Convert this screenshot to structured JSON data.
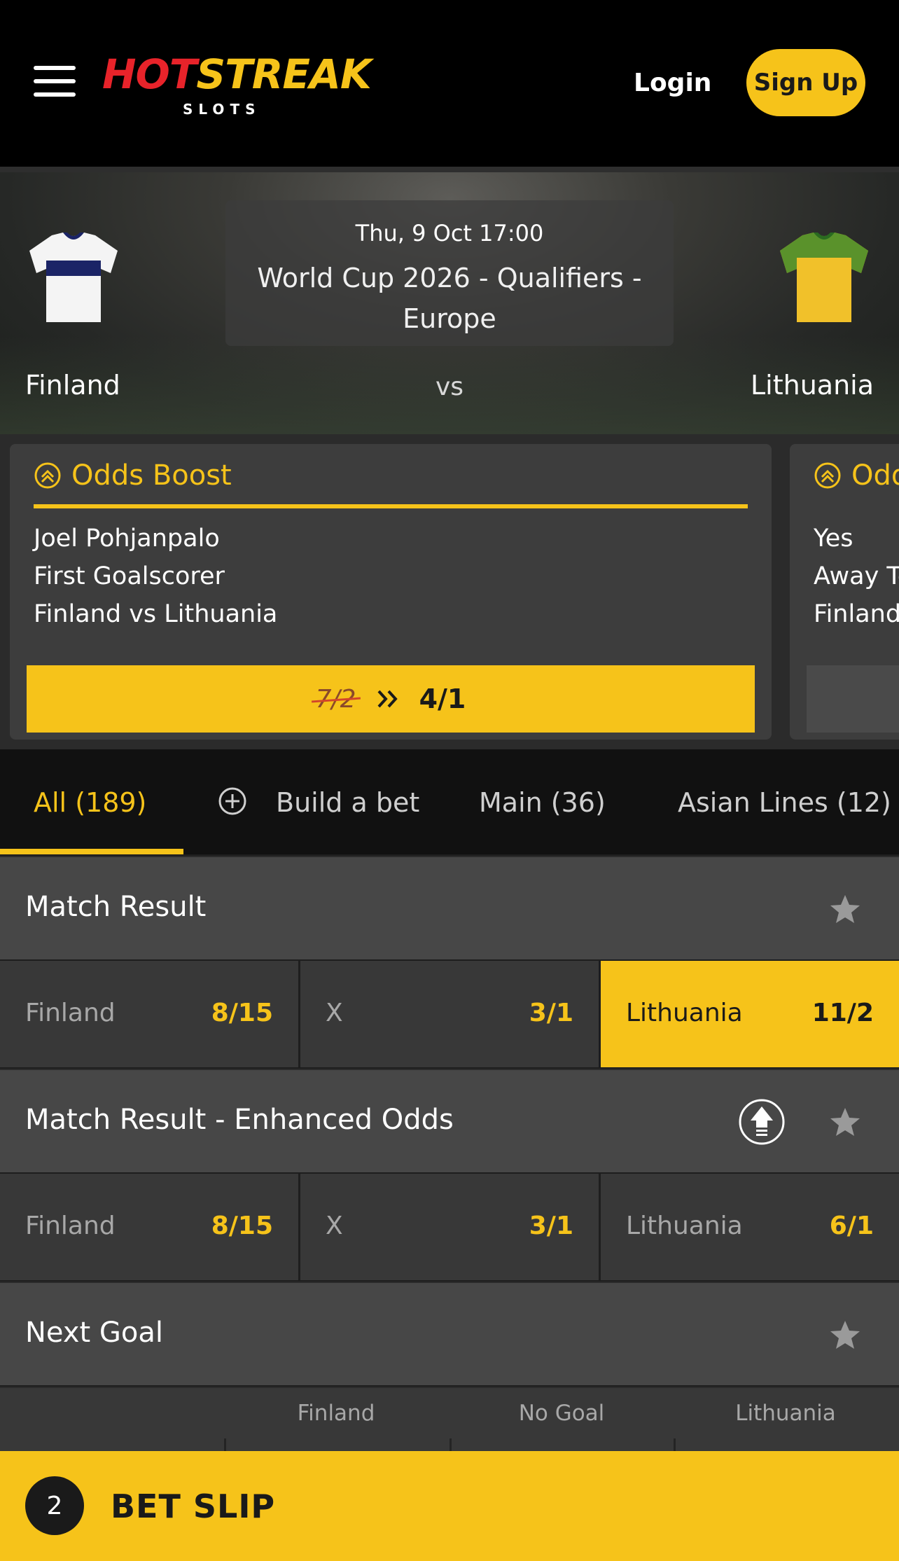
{
  "header": {
    "logo_hot": "HOT",
    "logo_streak": "STREAK",
    "logo_sub": "SLOTS",
    "login_label": "Login",
    "signup_label": "Sign Up"
  },
  "event": {
    "datetime": "Thu, 9 Oct 17:00",
    "competition": "World Cup 2026 - Qualifiers - Europe",
    "home_team": "Finland",
    "vs": "vs",
    "away_team": "Lithuania"
  },
  "boosts": [
    {
      "title": "Odds Boost",
      "lines": [
        "Joel Pohjanpalo",
        "First Goalscorer",
        "Finland vs Lithuania"
      ],
      "old_price": "7/2",
      "new_price": "4/1"
    },
    {
      "title": "Odds Boost",
      "lines": [
        "Yes",
        "Away Team",
        "Finland vs Lithuania"
      ]
    }
  ],
  "tabs": [
    {
      "label": "All (189)"
    },
    {
      "label": "Build a bet"
    },
    {
      "label": "Main (36)"
    },
    {
      "label": "Asian Lines (12)"
    }
  ],
  "markets": [
    {
      "title": "Match Result",
      "selections": [
        {
          "label": "Finland",
          "odds": "8/15"
        },
        {
          "label": "X",
          "odds": "3/1"
        },
        {
          "label": "Lithuania",
          "odds": "11/2"
        }
      ]
    },
    {
      "title": "Match Result - Enhanced Odds",
      "selections": [
        {
          "label": "Finland",
          "odds": "8/15"
        },
        {
          "label": "X",
          "odds": "3/1"
        },
        {
          "label": "Lithuania",
          "odds": "6/1"
        }
      ]
    },
    {
      "title": "Next Goal",
      "columns": [
        "Finland",
        "No Goal",
        "Lithuania"
      ]
    }
  ],
  "bet_slip": {
    "count": "2",
    "label": "BET SLIP"
  },
  "colors": {
    "accent": "#f6c31a",
    "brand_red": "#e8232a",
    "background": "#1e1e1e"
  }
}
